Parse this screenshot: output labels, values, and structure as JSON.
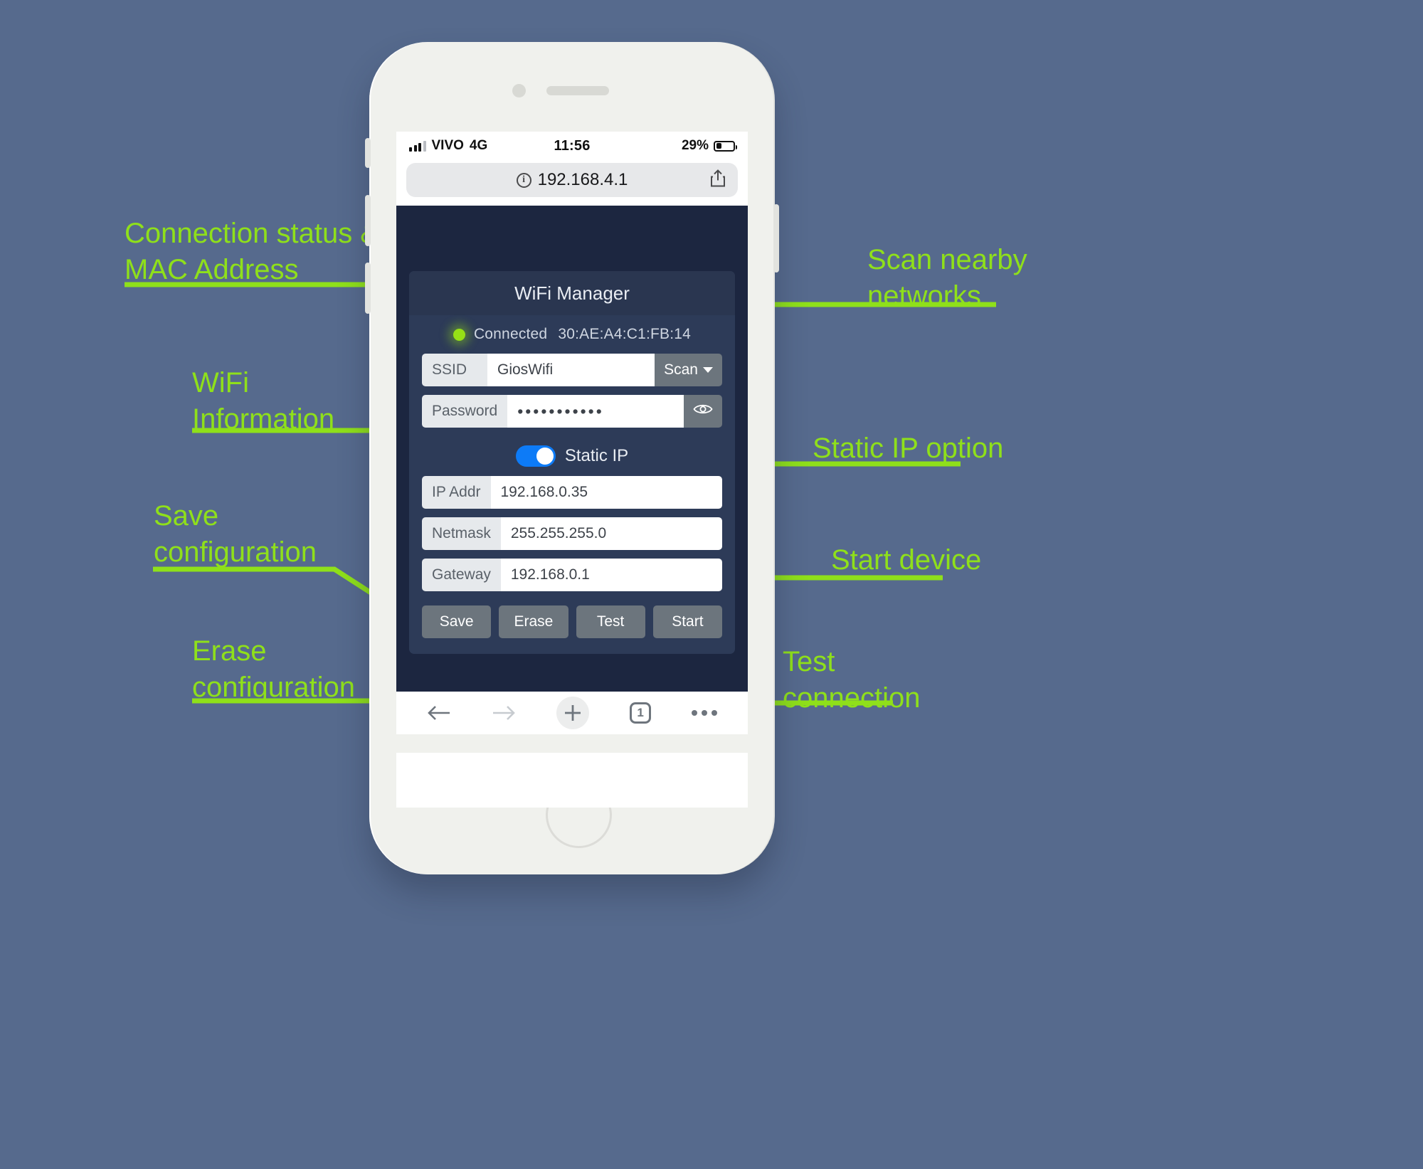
{
  "theme": {
    "background": "#566a8d",
    "accent_green": "#8fe01a",
    "page_dark": "#1c2640",
    "card": "#2d3b58",
    "button_gray": "#6c757d",
    "toggle_blue": "#0d7bf7"
  },
  "phone": {
    "status_bar": {
      "carrier": "VIVO",
      "network": "4G",
      "time": "11:56",
      "battery_percent": "29%"
    },
    "browser": {
      "url": "192.168.4.1",
      "info_icon": "info-icon",
      "share_icon": "share-icon",
      "toolbar": {
        "back_icon": "back-arrow-icon",
        "forward_icon": "forward-arrow-icon",
        "add_icon": "plus-icon",
        "tabs_count": "1",
        "more_icon": "more-dots-icon"
      }
    }
  },
  "app": {
    "title": "WiFi Manager",
    "status": {
      "indicator": "green-led-icon",
      "state": "Connected",
      "mac_address": "30:AE:A4:C1:FB:14"
    },
    "fields": [
      {
        "label": "SSID",
        "value": "GiosWifi",
        "action": "Scan",
        "action_icon": "chevron-down-icon"
      },
      {
        "label": "Password",
        "value": "•••••••••••",
        "action_icon": "eye-icon"
      },
      {
        "label": "IP Addr",
        "value": "192.168.0.35"
      },
      {
        "label": "Netmask",
        "value": "255.255.255.0"
      },
      {
        "label": "Gateway",
        "value": "192.168.0.1"
      }
    ],
    "static_ip": {
      "label": "Static IP",
      "enabled": true
    },
    "buttons": [
      {
        "label": "Save"
      },
      {
        "label": "Erase"
      },
      {
        "label": "Test"
      },
      {
        "label": "Start"
      }
    ]
  },
  "annotations": [
    {
      "id": "connection-status",
      "text": "Connection status &\nMAC Address"
    },
    {
      "id": "wifi-information",
      "text": "WiFi\nInformation"
    },
    {
      "id": "save-configuration",
      "text": "Save\nconfiguration"
    },
    {
      "id": "erase-configuration",
      "text": "Erase\nconfiguration"
    },
    {
      "id": "scan-nearby",
      "text": "Scan nearby\nnetworks"
    },
    {
      "id": "static-ip-option",
      "text": "Static IP option"
    },
    {
      "id": "start-device",
      "text": "Start device"
    },
    {
      "id": "test-connection",
      "text": "Test\nconnection"
    }
  ]
}
